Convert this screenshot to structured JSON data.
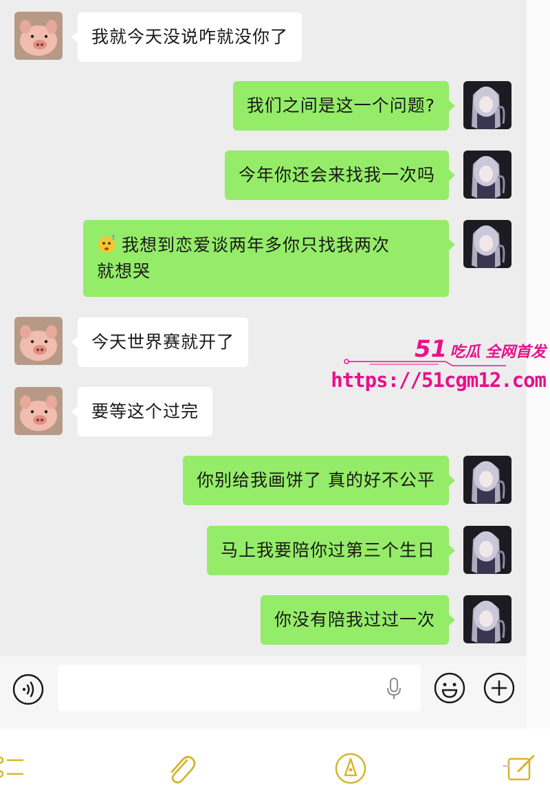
{
  "messages": [
    {
      "side": "left",
      "avatar": "pig-avatar",
      "text": "我就今天没说咋就没你了"
    },
    {
      "side": "right",
      "avatar": "anime-girl-avatar",
      "text": "我们之间是这一个问题?"
    },
    {
      "side": "right",
      "avatar": "anime-girl-avatar",
      "text": "今年你还会来找我一次吗"
    },
    {
      "side": "right",
      "avatar": "anime-girl-avatar",
      "emoji": "confused-face-emoji",
      "text_line1": "我想到恋爱谈两年多你只找我两次",
      "text_line2": "就想哭"
    },
    {
      "side": "left",
      "avatar": "pig-avatar",
      "text": "今天世界赛就开了"
    },
    {
      "side": "left",
      "avatar": "pig-avatar",
      "text": "要等这个过完"
    },
    {
      "side": "right",
      "avatar": "anime-girl-avatar",
      "text": "你别给我画饼了 真的好不公平"
    },
    {
      "side": "right",
      "avatar": "anime-girl-avatar",
      "text": "马上我要陪你过第三个生日"
    },
    {
      "side": "right",
      "avatar": "anime-girl-avatar",
      "text": "你没有陪我过过一次"
    }
  ],
  "watermark": {
    "brand_number": "51",
    "brand_text": "吃瓜 全网首发",
    "url": "https://51cgm12.com"
  },
  "input_bar": {
    "placeholder": "",
    "icons": [
      "voice-icon",
      "microphone-icon",
      "emoji-icon",
      "plus-icon"
    ]
  },
  "notes_toolbar": {
    "icons": [
      "checklist-icon",
      "paperclip-icon",
      "pen-icon",
      "edit-icon"
    ]
  },
  "colors": {
    "chat_background": "#ededed",
    "incoming_bubble": "#ffffff",
    "outgoing_bubble": "#95ec69",
    "watermark": "#e8108a",
    "toolbar_accent": "#d4b42c"
  }
}
